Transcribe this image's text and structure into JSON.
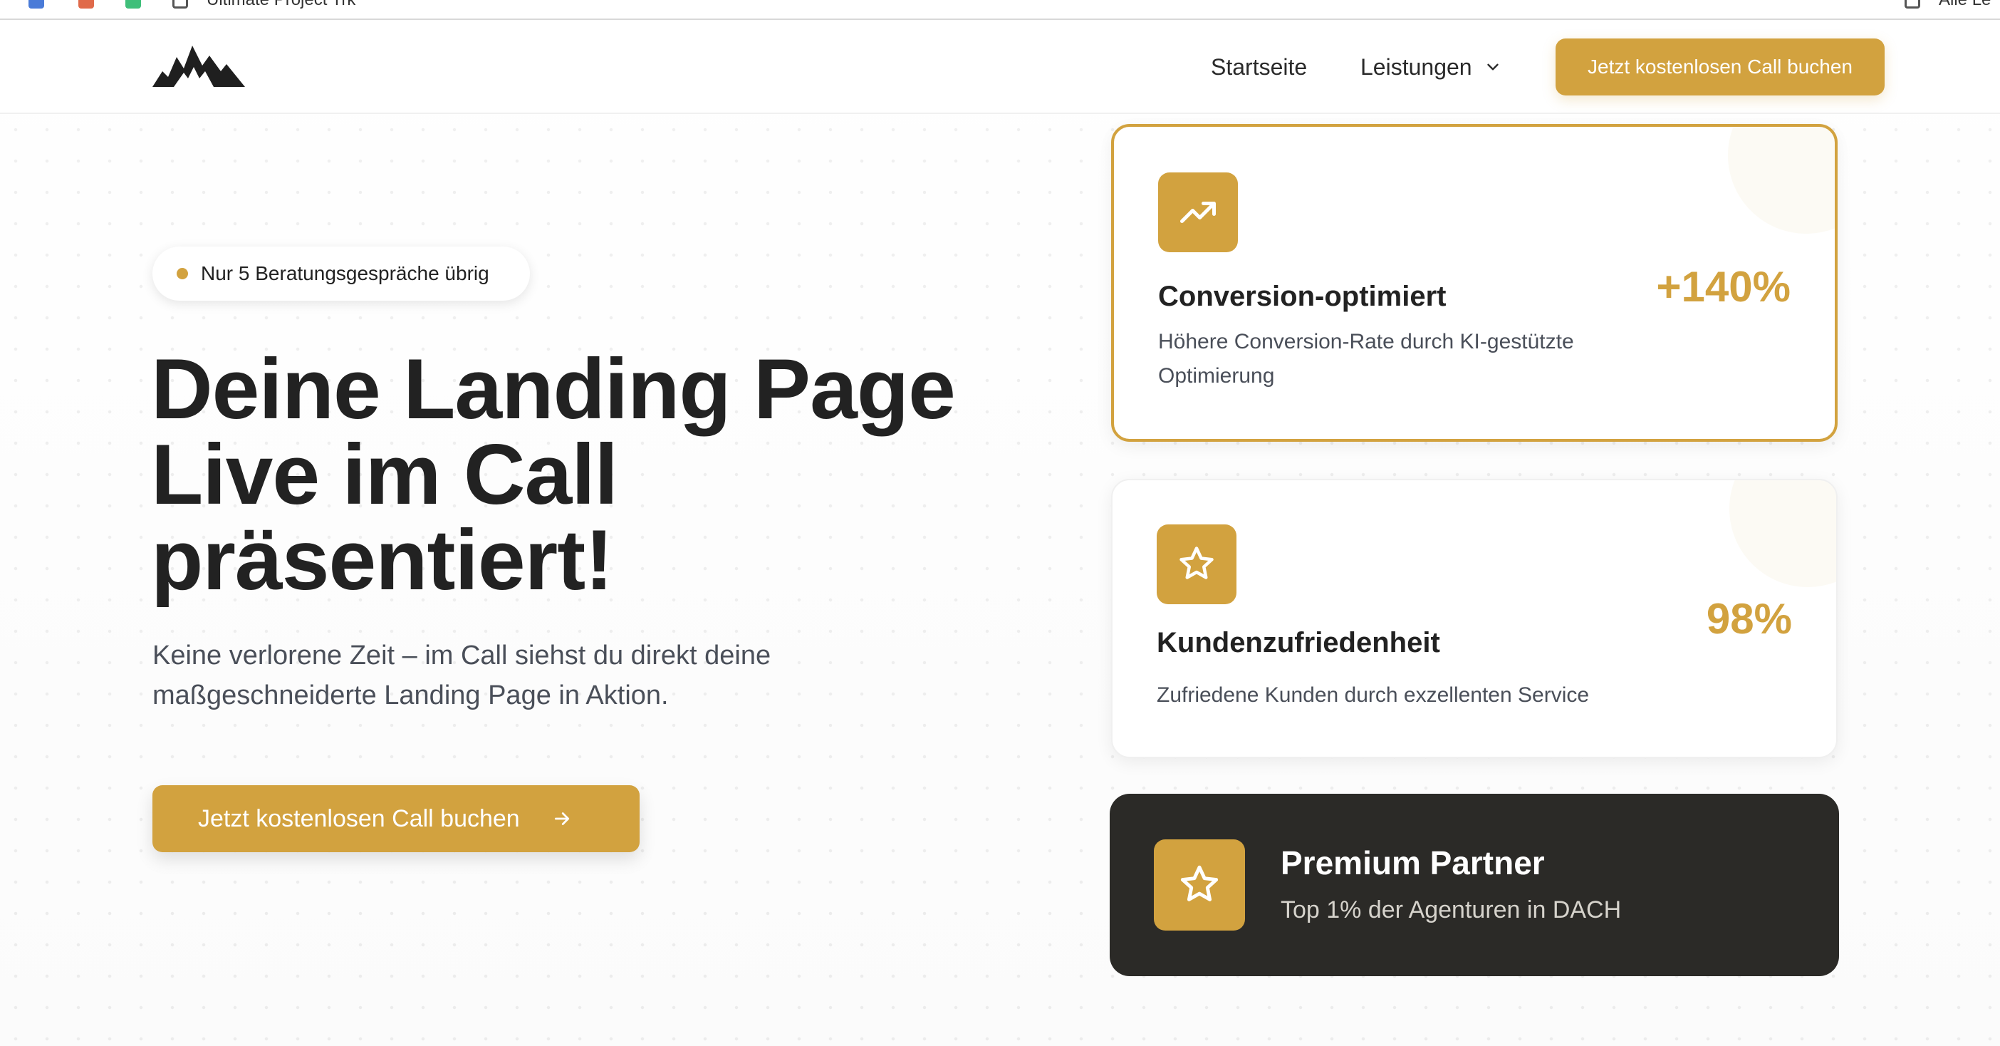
{
  "colors": {
    "accent": "#d2a23f",
    "text_dark": "#222222",
    "text_muted": "#4a4f59",
    "dark_card": "#2b2a27"
  },
  "browser": {
    "tab_text": "Ultimate Project Trk",
    "right_tab_text": "Alle Le"
  },
  "nav": {
    "logo_icon": "mountain-logo-icon",
    "links": [
      "Startseite",
      "Leistungen"
    ],
    "dropdown_icon": "chevron-down-icon",
    "cta_label": "Jetzt kostenlosen Call buchen"
  },
  "hero": {
    "badge": "Nur 5 Beratungsgespräche übrig",
    "title_lines": [
      "Deine Landing Page",
      "Live im Call",
      "präsentiert!"
    ],
    "subtitle_lines": [
      "Keine verlorene Zeit – im Call siehst du direkt deine",
      "maßgeschneiderte Landing Page in Aktion."
    ],
    "cta_label": "Jetzt kostenlosen Call buchen",
    "cta_icon": "arrow-right-icon"
  },
  "cards": [
    {
      "icon": "trending-up-icon",
      "title": "Conversion-optimiert",
      "description_lines": [
        "Höhere Conversion-Rate durch KI-gestützte",
        "Optimierung"
      ],
      "stat": "+140%"
    },
    {
      "icon": "star-icon",
      "title": "Kundenzufriedenheit",
      "description_lines": [
        "Zufriedene Kunden durch exzellenten Service"
      ],
      "stat": "98%"
    }
  ],
  "partner": {
    "icon": "star-icon",
    "title": "Premium Partner",
    "subtitle": "Top 1% der Agenturen in DACH"
  }
}
